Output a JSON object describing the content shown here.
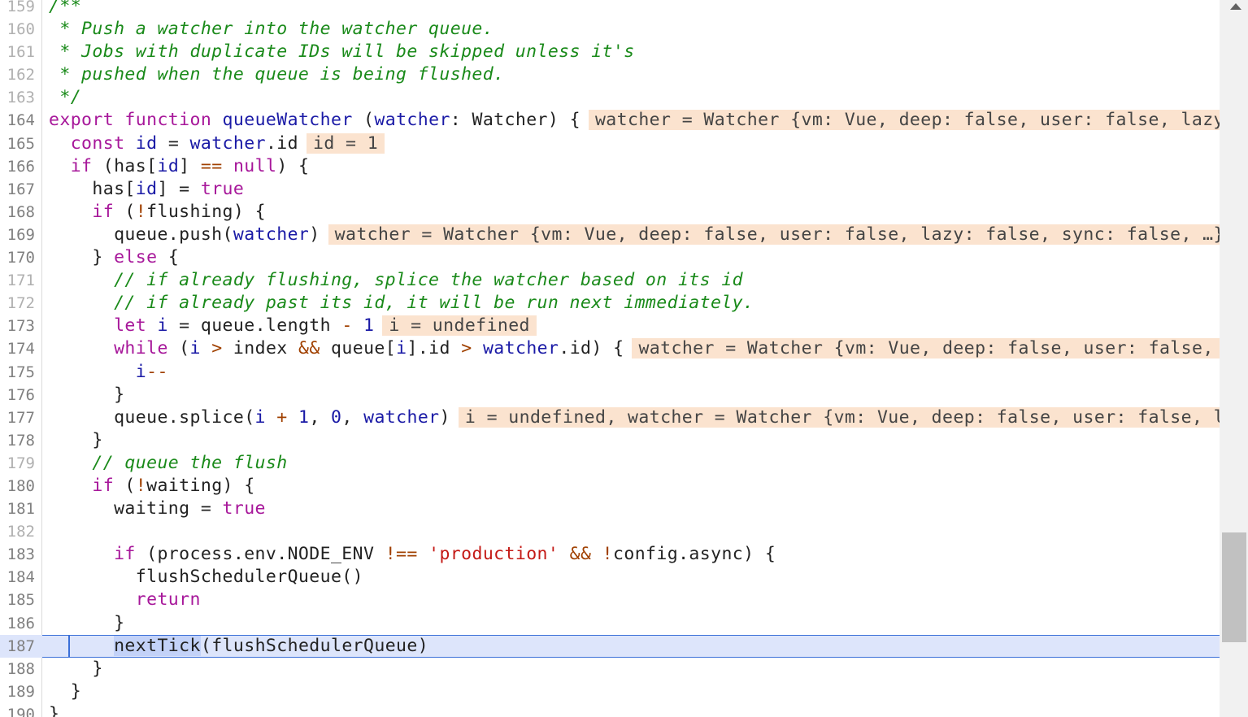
{
  "lines": [
    {
      "n": "159",
      "dim": true,
      "code": [
        {
          "t": "/**",
          "c": "cm"
        }
      ]
    },
    {
      "n": "160",
      "dim": true,
      "code": [
        {
          "t": " * Push a watcher into the watcher queue.",
          "c": "cm"
        }
      ]
    },
    {
      "n": "161",
      "dim": true,
      "code": [
        {
          "t": " * Jobs with duplicate IDs will be skipped unless it's",
          "c": "cm"
        }
      ]
    },
    {
      "n": "162",
      "dim": true,
      "code": [
        {
          "t": " * pushed when the queue is being flushed.",
          "c": "cm"
        }
      ]
    },
    {
      "n": "163",
      "dim": true,
      "code": [
        {
          "t": " */",
          "c": "cm"
        }
      ]
    },
    {
      "n": "164",
      "dim": false,
      "code": [
        {
          "t": "export ",
          "c": "kw"
        },
        {
          "t": "function ",
          "c": "kw"
        },
        {
          "t": "queueWatcher",
          "c": "fn"
        },
        {
          "t": " ("
        },
        {
          "t": "watcher",
          "c": "var"
        },
        {
          "t": ": Watcher) {"
        }
      ],
      "hint": "watcher = Watcher {vm: Vue, deep: false, user: false, lazy"
    },
    {
      "n": "165",
      "dim": false,
      "code": [
        {
          "t": "  const ",
          "c": "kw"
        },
        {
          "t": "id",
          "c": "var"
        },
        {
          "t": " = "
        },
        {
          "t": "watcher",
          "c": "var"
        },
        {
          "t": ".id"
        }
      ],
      "hint": "id = 1"
    },
    {
      "n": "166",
      "dim": false,
      "code": [
        {
          "t": "  if ",
          "c": "kw"
        },
        {
          "t": "(has["
        },
        {
          "t": "id",
          "c": "var"
        },
        {
          "t": "] "
        },
        {
          "t": "==",
          "c": "op"
        },
        {
          "t": " "
        },
        {
          "t": "null",
          "c": "kw"
        },
        {
          "t": ") {"
        }
      ]
    },
    {
      "n": "167",
      "dim": false,
      "code": [
        {
          "t": "    has["
        },
        {
          "t": "id",
          "c": "var"
        },
        {
          "t": "] = "
        },
        {
          "t": "true",
          "c": "kw"
        }
      ]
    },
    {
      "n": "168",
      "dim": false,
      "code": [
        {
          "t": "    if ",
          "c": "kw"
        },
        {
          "t": "("
        },
        {
          "t": "!",
          "c": "op"
        },
        {
          "t": "flushing) {"
        }
      ]
    },
    {
      "n": "169",
      "dim": false,
      "code": [
        {
          "t": "      queue.push("
        },
        {
          "t": "watcher",
          "c": "var"
        },
        {
          "t": ")"
        }
      ],
      "hint": "watcher = Watcher {vm: Vue, deep: false, user: false, lazy: false, sync: false, …}"
    },
    {
      "n": "170",
      "dim": false,
      "code": [
        {
          "t": "    } "
        },
        {
          "t": "else",
          "c": "kw"
        },
        {
          "t": " {"
        }
      ]
    },
    {
      "n": "171",
      "dim": true,
      "code": [
        {
          "t": "      // if already flushing, splice the watcher based on its id",
          "c": "cm"
        }
      ]
    },
    {
      "n": "172",
      "dim": true,
      "code": [
        {
          "t": "      // if already past its id, it will be run next immediately.",
          "c": "cm"
        }
      ]
    },
    {
      "n": "173",
      "dim": false,
      "code": [
        {
          "t": "      let ",
          "c": "kw"
        },
        {
          "t": "i",
          "c": "var"
        },
        {
          "t": " = queue.length "
        },
        {
          "t": "-",
          "c": "op"
        },
        {
          "t": " "
        },
        {
          "t": "1",
          "c": "num"
        }
      ],
      "hint": "i = undefined"
    },
    {
      "n": "174",
      "dim": false,
      "code": [
        {
          "t": "      while ",
          "c": "kw"
        },
        {
          "t": "("
        },
        {
          "t": "i",
          "c": "var"
        },
        {
          "t": " "
        },
        {
          "t": ">",
          "c": "op"
        },
        {
          "t": " index "
        },
        {
          "t": "&&",
          "c": "op"
        },
        {
          "t": " queue["
        },
        {
          "t": "i",
          "c": "var"
        },
        {
          "t": "].id "
        },
        {
          "t": ">",
          "c": "op"
        },
        {
          "t": " "
        },
        {
          "t": "watcher",
          "c": "var"
        },
        {
          "t": ".id) {"
        }
      ],
      "hint": "watcher = Watcher {vm: Vue, deep: false, user: false, "
    },
    {
      "n": "175",
      "dim": false,
      "code": [
        {
          "t": "        "
        },
        {
          "t": "i",
          "c": "var"
        },
        {
          "t": "--",
          "c": "op"
        }
      ]
    },
    {
      "n": "176",
      "dim": false,
      "code": [
        {
          "t": "      }"
        }
      ]
    },
    {
      "n": "177",
      "dim": false,
      "code": [
        {
          "t": "      queue.splice("
        },
        {
          "t": "i",
          "c": "var"
        },
        {
          "t": " "
        },
        {
          "t": "+",
          "c": "op"
        },
        {
          "t": " "
        },
        {
          "t": "1",
          "c": "num"
        },
        {
          "t": ", "
        },
        {
          "t": "0",
          "c": "num"
        },
        {
          "t": ", "
        },
        {
          "t": "watcher",
          "c": "var"
        },
        {
          "t": ")"
        }
      ],
      "hint": "i = undefined, watcher = Watcher {vm: Vue, deep: false, user: false, l"
    },
    {
      "n": "178",
      "dim": false,
      "code": [
        {
          "t": "    }"
        }
      ]
    },
    {
      "n": "179",
      "dim": true,
      "code": [
        {
          "t": "    // queue the flush",
          "c": "cm"
        }
      ]
    },
    {
      "n": "180",
      "dim": false,
      "code": [
        {
          "t": "    if ",
          "c": "kw"
        },
        {
          "t": "("
        },
        {
          "t": "!",
          "c": "op"
        },
        {
          "t": "waiting) {"
        }
      ]
    },
    {
      "n": "181",
      "dim": false,
      "code": [
        {
          "t": "      waiting = "
        },
        {
          "t": "true",
          "c": "kw"
        }
      ]
    },
    {
      "n": "182",
      "dim": true,
      "code": []
    },
    {
      "n": "183",
      "dim": false,
      "code": [
        {
          "t": "      if ",
          "c": "kw"
        },
        {
          "t": "(process.env.NODE_ENV "
        },
        {
          "t": "!==",
          "c": "op"
        },
        {
          "t": " "
        },
        {
          "t": "'production'",
          "c": "str"
        },
        {
          "t": " "
        },
        {
          "t": "&&",
          "c": "op"
        },
        {
          "t": " "
        },
        {
          "t": "!",
          "c": "op"
        },
        {
          "t": "config.async) {"
        }
      ]
    },
    {
      "n": "184",
      "dim": false,
      "code": [
        {
          "t": "        flushSchedulerQueue()"
        }
      ]
    },
    {
      "n": "185",
      "dim": false,
      "code": [
        {
          "t": "        return",
          "c": "kw"
        }
      ]
    },
    {
      "n": "186",
      "dim": false,
      "code": [
        {
          "t": "      }"
        }
      ]
    },
    {
      "n": "187",
      "dim": false,
      "current": true,
      "code": [
        {
          "t": "      "
        },
        {
          "t": "nextTick",
          "c": "sel"
        },
        {
          "t": "(flushSchedulerQueue)"
        }
      ]
    },
    {
      "n": "188",
      "dim": false,
      "code": [
        {
          "t": "    }"
        }
      ]
    },
    {
      "n": "189",
      "dim": false,
      "code": [
        {
          "t": "  }"
        }
      ]
    },
    {
      "n": "190",
      "dim": false,
      "code": [
        {
          "t": "}"
        }
      ]
    }
  ]
}
